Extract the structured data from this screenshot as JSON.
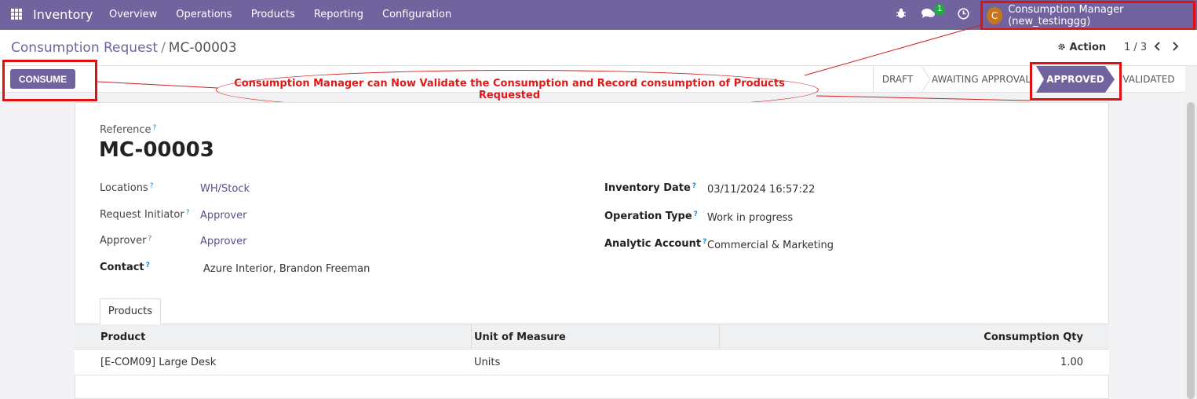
{
  "navbar": {
    "app_name": "Inventory",
    "menu": [
      "Overview",
      "Operations",
      "Products",
      "Reporting",
      "Configuration"
    ],
    "chat_badge": "1",
    "user": {
      "initial": "C",
      "name": "Consumption Manager (new_testinggg)"
    }
  },
  "breadcrumb": {
    "parent": "Consumption Request",
    "separator": "/",
    "current": "MC-00003"
  },
  "control": {
    "action_label": "Action",
    "pager": "1 / 3"
  },
  "statusbar": {
    "consume_label": "CONSUME",
    "stages": [
      "DRAFT",
      "AWAITING APPROVAL",
      "APPROVED",
      "VALIDATED"
    ],
    "active_stage": "APPROVED"
  },
  "annotation": {
    "text": "Consumption Manager can Now Validate the Consumption and Record consumption of Products Requested"
  },
  "form": {
    "reference_label": "Reference",
    "reference_value": "MC-00003",
    "left_fields": [
      {
        "label": "Locations",
        "value": "WH/Stock"
      },
      {
        "label": "Request Initiator",
        "value": "Approver"
      },
      {
        "label": "Approver",
        "value": "Approver"
      },
      {
        "label": "Contact",
        "value": "Azure Interior, Brandon Freeman"
      }
    ],
    "right_fields": [
      {
        "label": "Inventory Date",
        "value": "03/11/2024 16:57:22"
      },
      {
        "label": "Operation Type",
        "value": "Work in progress"
      },
      {
        "label": "Analytic Account",
        "value": "Commercial & Marketing"
      }
    ],
    "help_mark": "?"
  },
  "tabs": {
    "products": "Products"
  },
  "table": {
    "headers": [
      "Product",
      "Unit of Measure",
      "Consumption Qty"
    ],
    "rows": [
      {
        "product": "[E-COM09] Large Desk",
        "uom": "Units",
        "qty": "1.00"
      }
    ]
  },
  "colors": {
    "brand": "#71639e",
    "annotation": "#e01010"
  }
}
